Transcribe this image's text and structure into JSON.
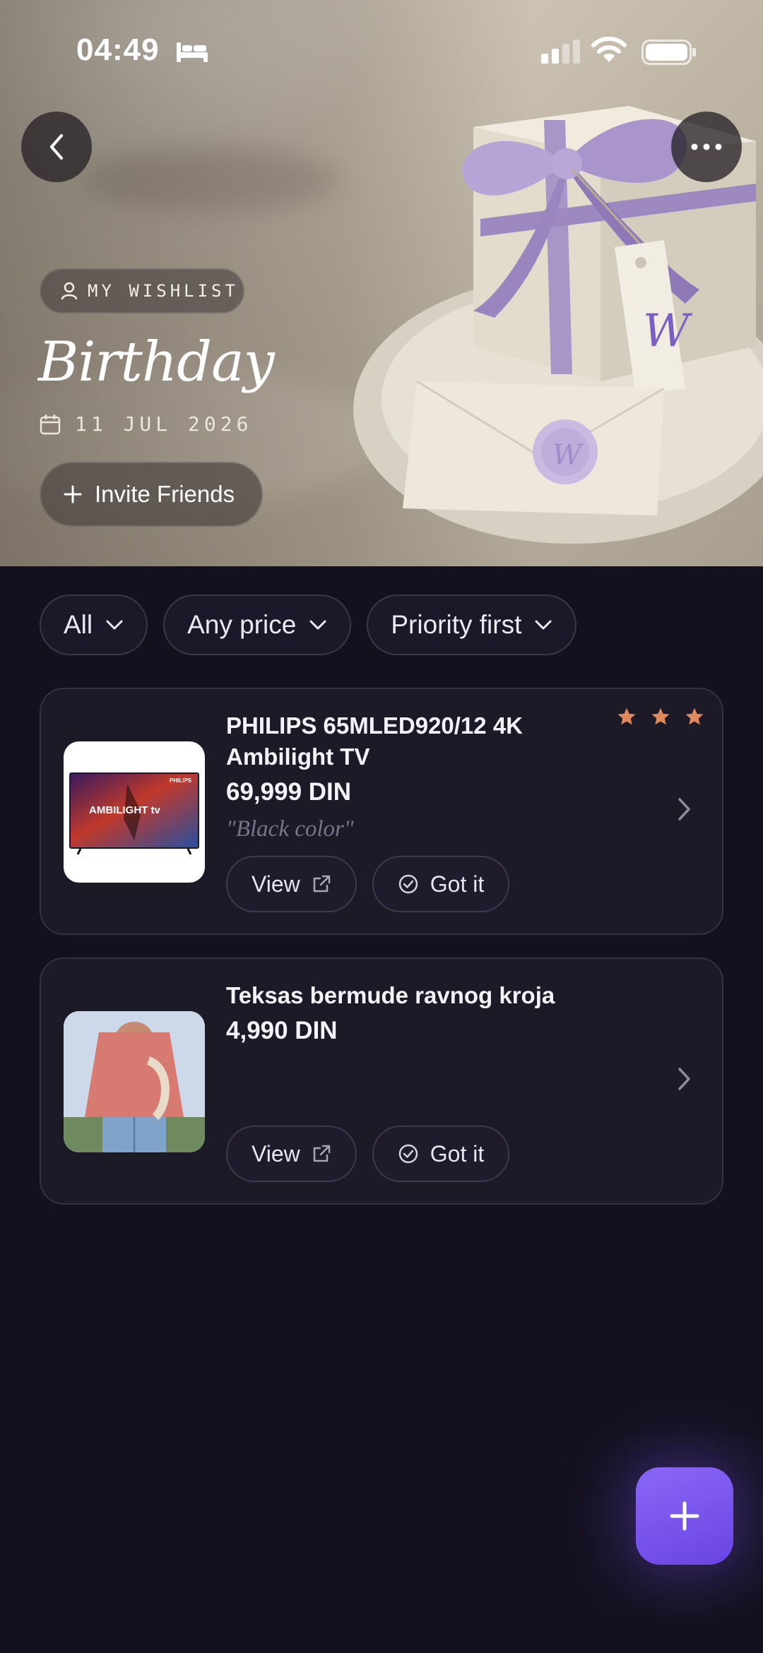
{
  "status_bar": {
    "time": "04:49"
  },
  "hero": {
    "owner_label": "MY WISHLIST",
    "title": "Birthday",
    "date": "11 JUL 2026",
    "invite_label": "Invite Friends"
  },
  "filters": [
    {
      "label": "All"
    },
    {
      "label": "Any price"
    },
    {
      "label": "Priority first"
    }
  ],
  "items": [
    {
      "name": "PHILIPS 65MLED920/12 4K Ambilight TV",
      "price": "69,999 DIN",
      "note": "\"Black color\"",
      "priority_stars": 3,
      "thumb_brand": "PHILIPS",
      "thumb_caption": "AMBILIGHT tv",
      "view_label": "View",
      "got_label": "Got it"
    },
    {
      "name": "Teksas bermude ravnog kroja",
      "price": "4,990 DIN",
      "view_label": "View",
      "got_label": "Got it"
    }
  ],
  "colors": {
    "background": "#14111f",
    "card": "#1d1a28",
    "star": "#e08a5c",
    "accent": "#7651ea"
  },
  "icons": [
    "bed-icon",
    "signal-icon",
    "wifi-icon",
    "battery-icon",
    "back-icon",
    "more-icon",
    "person-icon",
    "calendar-icon",
    "plus-icon",
    "chevron-down-icon",
    "star-icon",
    "external-link-icon",
    "check-circle-icon",
    "chevron-right-icon"
  ]
}
